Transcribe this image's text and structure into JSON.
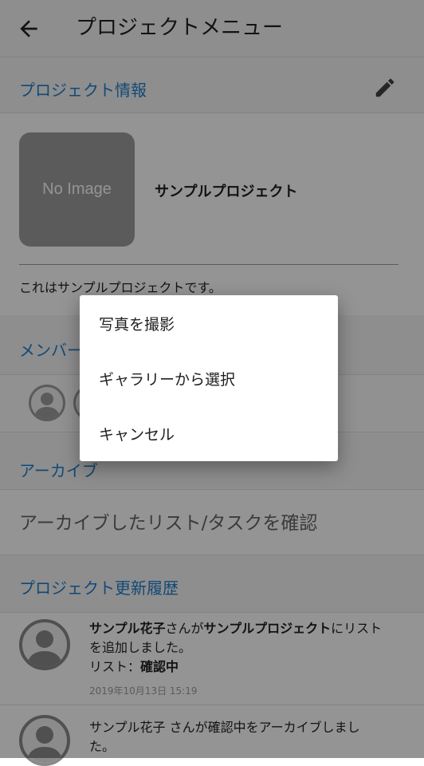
{
  "header": {
    "title": "プロジェクトメニュー",
    "back_icon": "arrow-left-icon"
  },
  "project_info": {
    "section_title": "プロジェクト情報",
    "edit_icon": "pencil-icon",
    "image_placeholder": "No Image",
    "name": "サンプルプロジェクト",
    "description": "これはサンプルプロジェクトです。"
  },
  "members": {
    "section_title": "メンバー"
  },
  "archive": {
    "section_title": "アーカイブ",
    "link_label": "アーカイブしたリスト/タスクを確認"
  },
  "history": {
    "section_title": "プロジェクト更新履歴",
    "items": [
      {
        "user": "サンプル花子",
        "t1": "さんが",
        "project": "サンプルプロジェクト",
        "t2": "にリスト",
        "t3": "を追加しました。",
        "list_prefix": "リスト：",
        "list_name": "確認中",
        "date": "2019年10月13日 15:19"
      },
      {
        "line1": "サンプル花子 さんが確認中をアーカイブしまし",
        "line2": "た。"
      }
    ]
  },
  "dialog": {
    "items": [
      "写真を撮影",
      "ギャラリーから選択",
      "キャンセル"
    ]
  },
  "colors": {
    "accent": "#1f7ecc",
    "scrim": "rgba(0,0,0,0.42)"
  }
}
